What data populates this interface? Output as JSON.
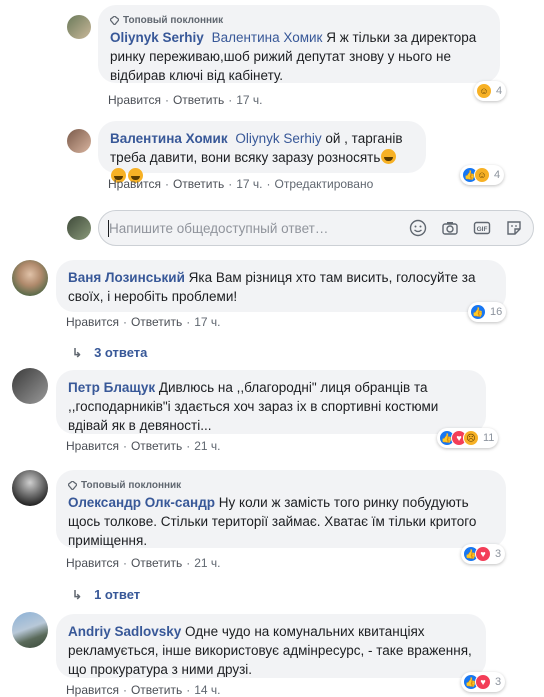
{
  "badge_label": "Топовый поклонник",
  "actions": {
    "like": "Нравится",
    "reply": "Ответить",
    "edited": "Отредактировано"
  },
  "reply_placeholder": "Напишите общедоступный ответ…",
  "comments": [
    {
      "author": "Oliynyk Serhiy",
      "mention": "Валентина Хомик",
      "text": " Я ж тільки за директора ринку переживаю,шоб рижий депутат знову у нього не відбирав ключі від кабінету.",
      "time": "17 ч.",
      "reactions_count": "4"
    },
    {
      "author": "Валентина Хомик",
      "mention": "Oliynyk Serhiy",
      "text": " ой , тарганів треба давити, вони всяку заразу розносять",
      "time": "17 ч.",
      "reactions_count": "4"
    },
    {
      "author": "Ваня Лозинський",
      "text": " Яка Вам різниця хто там висить, голосуйте за своїх, і неробіть проблеми!",
      "time": "17 ч.",
      "reactions_count": "16",
      "replies": "3 ответа"
    },
    {
      "author": "Петр Блащук",
      "text": " Дивлюсь на ,,благородні\" лиця обранців та ,,господарників\"і здається хоч зараз іх в спортивні костюми вдівай як в девяності...",
      "time": "21 ч.",
      "reactions_count": "11"
    },
    {
      "author": "Олександр Олк-сандр",
      "text": " Ну коли ж замість того ринку побудують щось толкове. Стільки території займає. Хватає їм тільки критого приміщення.",
      "time": "21 ч.",
      "reactions_count": "3",
      "replies": "1 ответ"
    },
    {
      "author": "Andriy Sadlovsky",
      "text": " Одне чудо на комунальних квитанціях рекламується, інше використовує адмінресурс, - таке враження, що прокуратура з ними друзі.",
      "time": "14 ч.",
      "reactions_count": "3"
    }
  ],
  "colors": {
    "link": "#385898",
    "bubble": "#f2f3f5",
    "like": "#1877f2",
    "love": "#f33e58",
    "haha": "#f7b125"
  }
}
